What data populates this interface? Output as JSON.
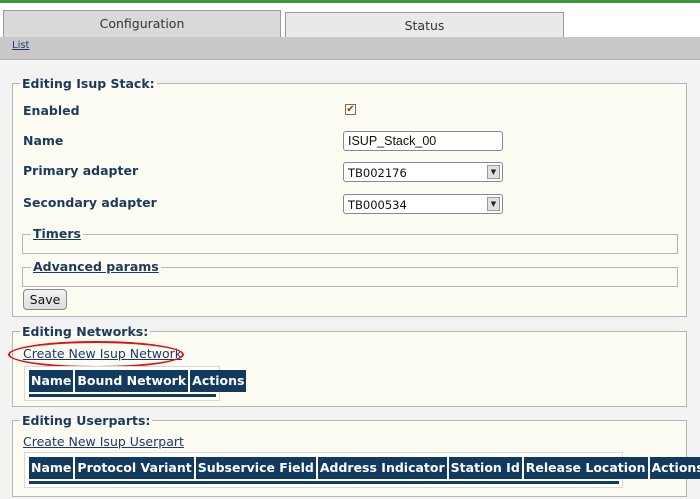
{
  "tabs": {
    "configuration": "Configuration",
    "status": "Status"
  },
  "subnav": {
    "list_link": "List"
  },
  "stack": {
    "legend": "Editing Isup Stack:",
    "enabled_label": "Enabled",
    "enabled_checked": true,
    "name_label": "Name",
    "name_value": "ISUP_Stack_00",
    "primary_label": "Primary adapter",
    "primary_value": "TB002176",
    "secondary_label": "Secondary adapter",
    "secondary_value": "TB000534",
    "timers_legend": "Timers",
    "advanced_legend": "Advanced params",
    "save_label": "Save"
  },
  "networks": {
    "legend": "Editing Networks:",
    "create_link": "Create New Isup Network",
    "columns": [
      "Name",
      "Bound Network",
      "Actions"
    ]
  },
  "userparts": {
    "legend": "Editing Userparts:",
    "create_link": "Create New Isup Userpart",
    "columns": [
      "Name",
      "Protocol Variant",
      "Subservice Field",
      "Address Indicator",
      "Station Id",
      "Release Location",
      "Actions"
    ]
  },
  "colors": {
    "header_bg": "#123a5f",
    "highlight": "#e01010",
    "tab_line": "#3c9a3c"
  },
  "icons": {
    "checkbox": "checkmark-icon",
    "dropdown": "chevron-down-icon"
  }
}
